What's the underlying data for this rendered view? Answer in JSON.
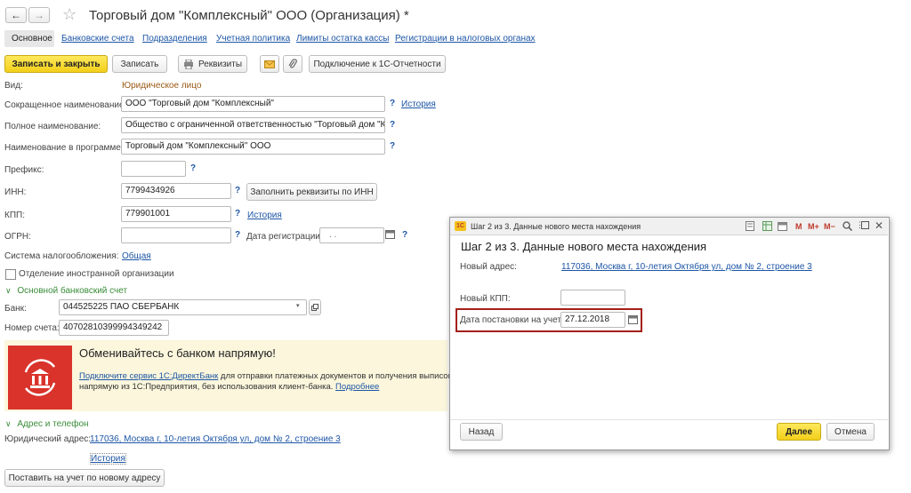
{
  "nav": {
    "back": "←",
    "forward": "→",
    "star": "☆"
  },
  "title": "Торговый дом \"Комплексный\" ООО (Организация) *",
  "tabs": [
    "Основное",
    "Банковские счета",
    "Подразделения",
    "Учетная политика",
    "Лимиты остатка кассы",
    "Регистрации в налоговых органах"
  ],
  "toolbar": {
    "save_close": "Записать и закрыть",
    "save": "Записать",
    "print": "Реквизиты",
    "connect": "Подключение к 1С-Отчетности"
  },
  "form": {
    "vid_label": "Вид:",
    "vid_value": "Юридическое лицо",
    "short_label": "Сокращенное наименование:",
    "short_value": "ООО \"Торговый дом \"Комплексный\"",
    "history": "История",
    "full_label": "Полное наименование:",
    "full_value": "Общество с ограниченной ответственностью \"Торговый дом \"Комп",
    "prog_label": "Наименование в программе:",
    "prog_value": "Торговый дом \"Комплексный\" ООО",
    "prefix_label": "Префикс:",
    "prefix_value": "",
    "inn_label": "ИНН:",
    "inn_value": "7799434926",
    "fill_inn": "Заполнить реквизиты по ИНН",
    "kpp_label": "КПП:",
    "kpp_value": "779901001",
    "ogrn_label": "ОГРН:",
    "ogrn_value": "",
    "reg_date_label": "Дата регистрации:",
    "reg_date_value": ". .",
    "tax_label": "Система налогообложения:",
    "tax_value": "Общая",
    "foreign_label": "Отделение иностранной организации",
    "q": "?"
  },
  "bank_section": {
    "header": "Основной банковский счет",
    "bank_label": "Банк:",
    "bank_value": "044525225 ПАО СБЕРБАНК",
    "acc_label": "Номер счета:",
    "acc_value": "40702810399994349242"
  },
  "banner": {
    "title": "Обменивайтесь с банком напрямую!",
    "link": "Подключите сервис 1С:ДиректБанк",
    "text1": " для отправки платежных документов и получения выписок",
    "text2": "напрямую из 1С:Предприятия, без использования клиент-банка.",
    "more": "Подробнее"
  },
  "address": {
    "header": "Адрес и телефон",
    "legal_label": "Юридический адрес:",
    "legal_value": "117036, Москва г, 10-летия Октября ул, дом № 2, строение 3",
    "history": "История",
    "button": "Поставить на учет по новому адресу"
  },
  "dialog": {
    "window_title": "Шаг 2 из 3. Данные нового места нахождения",
    "heading": "Шаг 2 из 3. Данные нового места нахождения",
    "tb_m": "M",
    "tb_mplus": "M+",
    "tb_mminus": "M−",
    "addr_label": "Новый адрес:",
    "addr_value": "117036, Москва г, 10-летия Октября ул, дом № 2, строение 3",
    "kpp_label": "Новый КПП:",
    "kpp_value": "",
    "date_label": "Дата постановки на учет:",
    "date_value": "27.12.2018",
    "back": "Назад",
    "next": "Далее",
    "cancel": "Отмена"
  },
  "colors": {
    "link": "#1d56a6",
    "accent_yellow": "#f3cf1a",
    "banner_bg": "#fbf6dc",
    "banner_red": "#d9332b",
    "highlight": "#a3201a",
    "green": "#3a8d3a"
  }
}
